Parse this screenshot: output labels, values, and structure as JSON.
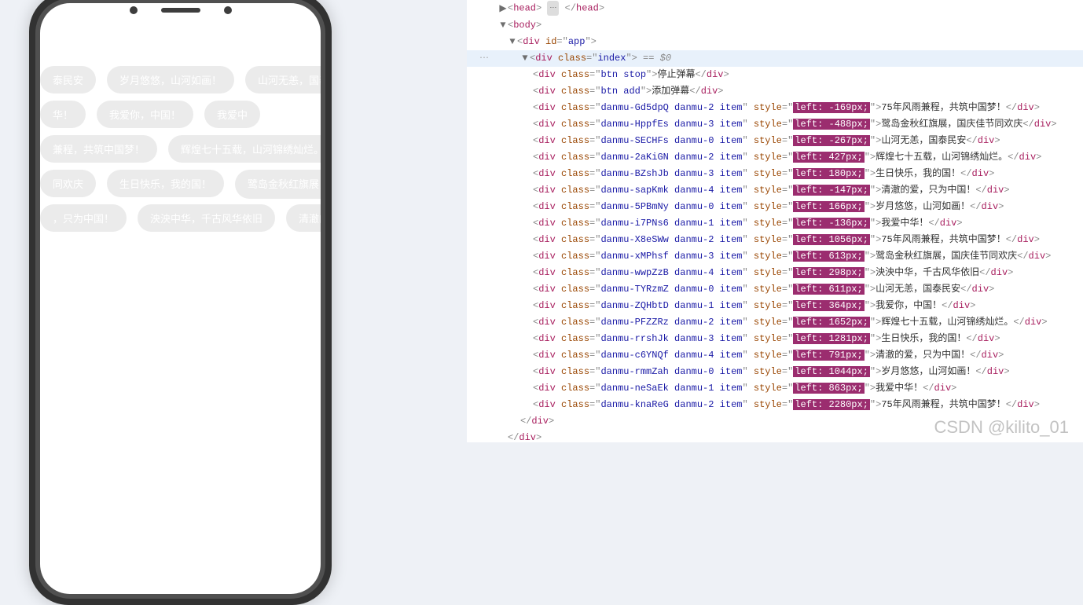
{
  "phone": {
    "rows": [
      [
        {
          "txt": "泰民安"
        },
        {
          "txt": "岁月悠悠，山河如画！"
        },
        {
          "txt": "山河无恙，国泰民安"
        }
      ],
      [
        {
          "txt": "华！"
        },
        {
          "txt": "我爱你，中国！"
        },
        {
          "txt": "我爱中"
        }
      ],
      [
        {
          "txt": "兼程，共筑中国梦！"
        },
        {
          "txt": "辉煌七十五载，山河锦绣灿烂。"
        }
      ],
      [
        {
          "txt": "同欢庆"
        },
        {
          "txt": "生日快乐，我的国！"
        },
        {
          "txt": "鹭岛金秋红旗展，",
          "heart": true
        }
      ],
      [
        {
          "txt": "，只为中国！"
        },
        {
          "txt": "泱泱中华，千古风华依旧"
        },
        {
          "txt": "清澈的爱"
        }
      ]
    ]
  },
  "devtools": {
    "head_open": "head",
    "body_open": "body",
    "app_id": "app",
    "index_cls": "index",
    "eq0": " == $0",
    "btn_stop_cls": "btn stop",
    "btn_stop_txt": "停止弹幕",
    "btn_add_cls": "btn add",
    "btn_add_txt": "添加弹幕",
    "items": [
      {
        "cls": "danmu-Gd5dpQ danmu-2 item",
        "style": "left: -169px;",
        "txt": "75年风雨兼程，共筑中国梦！"
      },
      {
        "cls": "danmu-HppfEs danmu-3 item",
        "style": "left: -488px;",
        "txt": "鹭岛金秋红旗展，国庆佳节同欢庆"
      },
      {
        "cls": "danmu-SECHFs danmu-0 item",
        "style": "left: -267px;",
        "txt": "山河无恙，国泰民安"
      },
      {
        "cls": "danmu-2aKiGN danmu-2 item",
        "style": "left: 427px;",
        "txt": "辉煌七十五载，山河锦绣灿烂。"
      },
      {
        "cls": "danmu-BZshJb danmu-3 item",
        "style": "left: 180px;",
        "txt": "生日快乐，我的国！"
      },
      {
        "cls": "danmu-sapKmk danmu-4 item",
        "style": "left: -147px;",
        "txt": "清澈的爱，只为中国！"
      },
      {
        "cls": "danmu-5PBmNy danmu-0 item",
        "style": "left: 166px;",
        "txt": "岁月悠悠，山河如画！"
      },
      {
        "cls": "danmu-i7PNs6 danmu-1 item",
        "style": "left: -136px;",
        "txt": "我爱中华！"
      },
      {
        "cls": "danmu-X8eSWw danmu-2 item",
        "style": "left: 1056px;",
        "txt": "75年风雨兼程，共筑中国梦！"
      },
      {
        "cls": "danmu-xMPhsf danmu-3 item",
        "style": "left: 613px;",
        "txt": "鹭岛金秋红旗展，国庆佳节同欢庆"
      },
      {
        "cls": "danmu-wwpZzB danmu-4 item",
        "style": "left: 298px;",
        "txt": "泱泱中华，千古风华依旧"
      },
      {
        "cls": "danmu-TYRzmZ danmu-0 item",
        "style": "left: 611px;",
        "txt": "山河无恙，国泰民安"
      },
      {
        "cls": "danmu-ZQHbtD danmu-1 item",
        "style": "left: 364px;",
        "txt": "我爱你，中国！"
      },
      {
        "cls": "danmu-PFZZRz danmu-2 item",
        "style": "left: 1652px;",
        "txt": "辉煌七十五载，山河锦绣灿烂。"
      },
      {
        "cls": "danmu-rrshJk danmu-3 item",
        "style": "left: 1281px;",
        "txt": "生日快乐，我的国！"
      },
      {
        "cls": "danmu-c6YNQf danmu-4 item",
        "style": "left: 791px;",
        "txt": "清澈的爱，只为中国！"
      },
      {
        "cls": "danmu-rmmZah danmu-0 item",
        "style": "left: 1044px;",
        "txt": "岁月悠悠，山河如画！"
      },
      {
        "cls": "danmu-neSaEk danmu-1 item",
        "style": "left: 863px;",
        "txt": "我爱中华！"
      },
      {
        "cls": "danmu-knaReG danmu-2 item",
        "style": "left: 2280px;",
        "txt": "75年风雨兼程，共筑中国梦！"
      }
    ],
    "script_src": "./js/index.js"
  },
  "watermark": "CSDN @kilito_01"
}
